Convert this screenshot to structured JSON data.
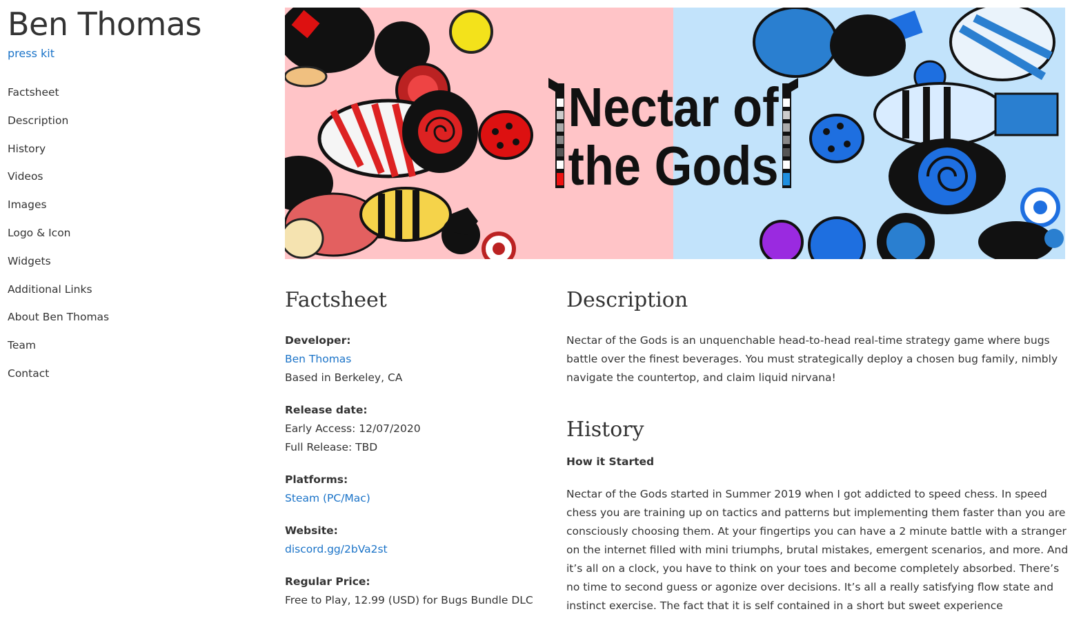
{
  "sidebar": {
    "title": "Ben Thomas",
    "press_kit": "press kit",
    "nav": [
      {
        "label": "Factsheet"
      },
      {
        "label": "Description"
      },
      {
        "label": "History"
      },
      {
        "label": "Videos"
      },
      {
        "label": "Images"
      },
      {
        "label": "Logo & Icon"
      },
      {
        "label": "Widgets"
      },
      {
        "label": "Additional Links"
      },
      {
        "label": "About Ben Thomas"
      },
      {
        "label": "Team"
      },
      {
        "label": "Contact"
      }
    ]
  },
  "banner": {
    "title_line1": "Nectar of",
    "title_line2": "the Gods",
    "left_color": "#ffc4c7",
    "right_color": "#c2e3fb"
  },
  "factsheet": {
    "heading": "Factsheet",
    "developer_label": "Developer:",
    "developer_name": "Ben Thomas",
    "developer_location": "Based in Berkeley, CA",
    "release_label": "Release date:",
    "release_early": "Early Access: 12/07/2020",
    "release_full": "Full Release: TBD",
    "platforms_label": "Platforms:",
    "platforms_value": "Steam (PC/Mac)",
    "website_label": "Website:",
    "website_value": "discord.gg/2bVa2st",
    "price_label": "Regular Price:",
    "price_value": "Free to Play, 12.99 (USD) for Bugs Bundle DLC"
  },
  "description": {
    "heading": "Description",
    "text": "Nectar of the Gods is an unquenchable head-to-head real-time strategy game where bugs battle over the finest beverages. You must strategically deploy a chosen bug family, nimbly navigate the countertop, and claim liquid nirvana!"
  },
  "history": {
    "heading": "History",
    "subheading": "How it Started",
    "text": "Nectar of the Gods started in Summer 2019 when I got addicted to speed chess. In speed chess you are training up on tactics and patterns but implementing them faster than you are consciously choosing them. At your fingertips you can have a 2 minute battle with a stranger on the internet filled with mini triumphs, brutal mistakes, emergent scenarios, and more. And it’s all on a clock, you have to think on your toes and become completely absorbed. There’s no time to second guess or agonize over decisions. It’s all a really satisfying flow state and instinct exercise. The fact that it is self contained in a short but sweet experience"
  },
  "colors": {
    "link": "#1a73c8",
    "text": "#333333"
  }
}
